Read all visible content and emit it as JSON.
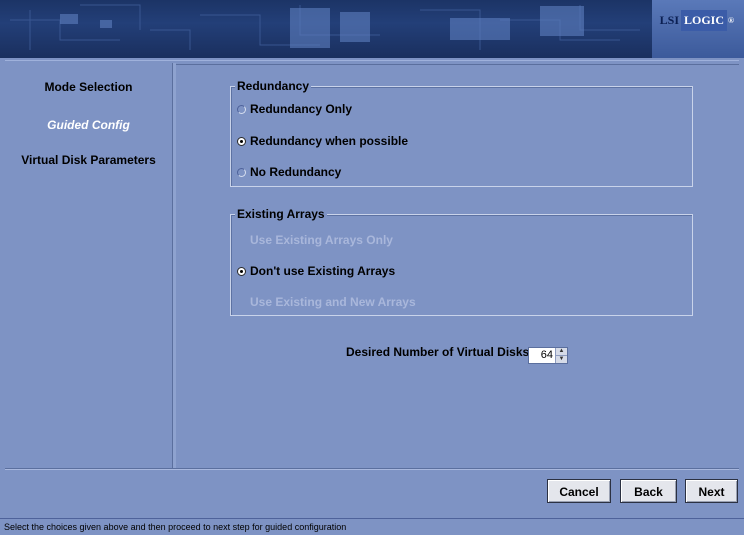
{
  "banner": {
    "logo_lsi": "LSI",
    "logo_logic": "LOGIC",
    "logo_mark": "®"
  },
  "sidebar": {
    "items": [
      {
        "label": "Mode Selection",
        "active": false
      },
      {
        "label": "Guided Config",
        "active": true
      },
      {
        "label": "Virtual Disk Parameters",
        "active": false
      }
    ]
  },
  "redundancy": {
    "title": "Redundancy",
    "options": [
      {
        "label": "Redundancy Only",
        "selected": false
      },
      {
        "label": "Redundancy when possible",
        "selected": true
      },
      {
        "label": "No Redundancy",
        "selected": false
      }
    ]
  },
  "existing_arrays": {
    "title": "Existing Arrays",
    "options": [
      {
        "label": "Use Existing Arrays Only",
        "selected": false,
        "enabled": false
      },
      {
        "label": "Don't use Existing Arrays",
        "selected": true,
        "enabled": true
      },
      {
        "label": "Use Existing and New Arrays",
        "selected": false,
        "enabled": false
      }
    ]
  },
  "virtual_disks": {
    "label": "Desired Number of Virtual Disks :",
    "value": "64"
  },
  "buttons": {
    "cancel": "Cancel",
    "back": "Back",
    "next": "Next"
  },
  "status": "Select the choices given above and then proceed to next step for guided configuration"
}
